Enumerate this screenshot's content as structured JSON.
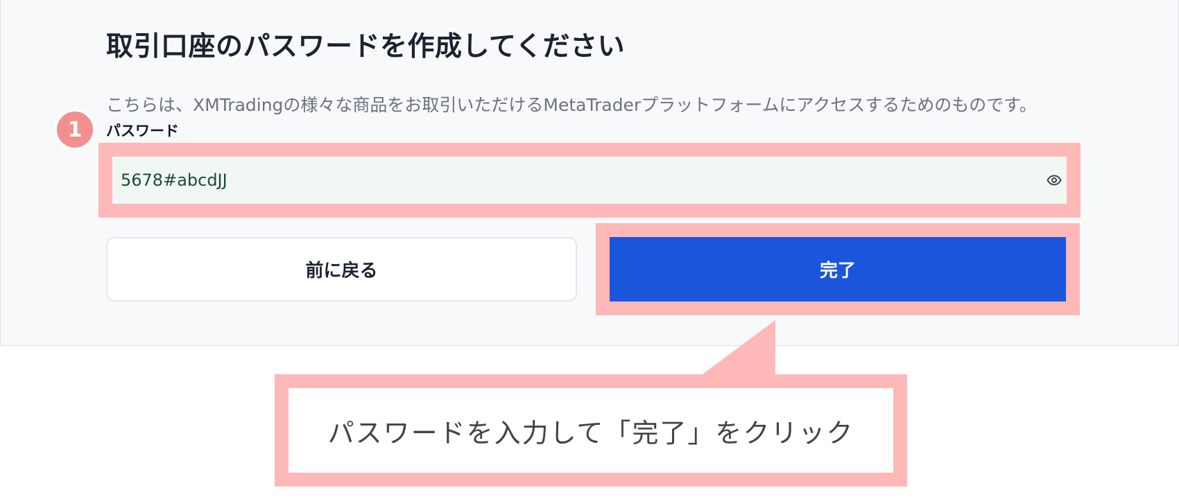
{
  "form": {
    "title": "取引口座のパスワードを作成してください",
    "description": "こちらは、XMTradingの様々な商品をお取引いただけるMetaTraderプラットフォームにアクセスするためのものです。",
    "step_number": "1",
    "password_label": "パスワード",
    "password_value": "5678#abcdJJ",
    "show_password_icon": "eye-icon",
    "back_button_label": "前に戻る",
    "complete_button_label": "完了"
  },
  "callout": {
    "text": "パスワードを入力して「完了」をクリック"
  },
  "colors": {
    "panel_background": "#f8f9fb",
    "highlight": "#ffb8b8",
    "primary_button": "#1b55dc",
    "step_badge": "#f38f8f",
    "input_background": "#f1f8f4"
  }
}
